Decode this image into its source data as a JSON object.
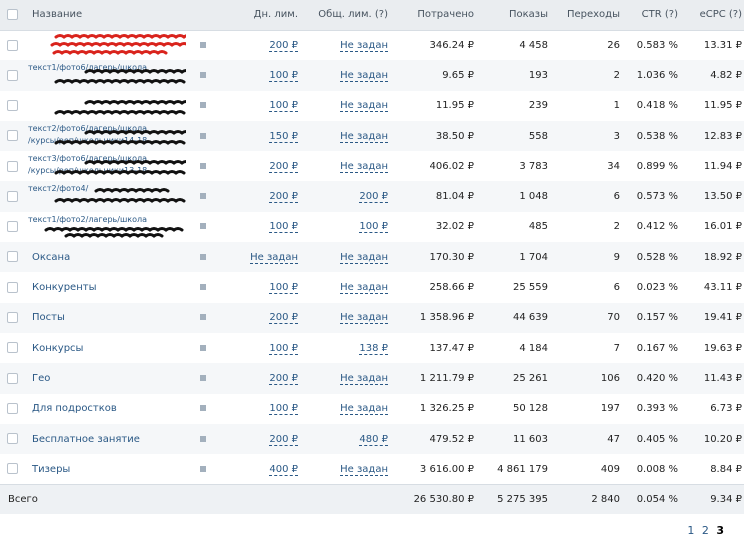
{
  "header": {
    "name": "Название",
    "daily": "Дн. лим.",
    "total_limit": "Общ. лим. (?)",
    "spent": "Потрачено",
    "impressions": "Показы",
    "clicks": "Переходы",
    "ctr": "CTR (?)",
    "ecpc": "eCPC (?)"
  },
  "rows": [
    {
      "name": "",
      "name_line2": "",
      "daily": "200 ₽",
      "total": "Не задан",
      "spent": "346.24 ₽",
      "impr": "4 458",
      "clicks": "26",
      "ctr": "0.583 %",
      "ecpc": "13.31 ₽"
    },
    {
      "name": "текст1/фото6/лагерь/школа",
      "name_line2": "",
      "daily": "100 ₽",
      "total": "Не задан",
      "spent": "9.65 ₽",
      "impr": "193",
      "clicks": "2",
      "ctr": "1.036 %",
      "ecpc": "4.82 ₽"
    },
    {
      "name": "",
      "name_line2": "",
      "daily": "100 ₽",
      "total": "Не задан",
      "spent": "11.95 ₽",
      "impr": "239",
      "clicks": "1",
      "ctr": "0.418 %",
      "ecpc": "11.95 ₽"
    },
    {
      "name": "текст2/фото6/лагерь/школа",
      "name_line2": "/курсы/реп/школьники14-18",
      "daily": "150 ₽",
      "total": "Не задан",
      "spent": "38.50 ₽",
      "impr": "558",
      "clicks": "3",
      "ctr": "0.538 %",
      "ecpc": "12.83 ₽"
    },
    {
      "name": "текст3/фото6/лагерь/школа",
      "name_line2": "/курсы/реп/школьники13-18",
      "daily": "200 ₽",
      "total": "Не задан",
      "spent": "406.02 ₽",
      "impr": "3 783",
      "clicks": "34",
      "ctr": "0.899 %",
      "ecpc": "11.94 ₽"
    },
    {
      "name": "текст2/фото4/",
      "name_line2": "",
      "daily": "200 ₽",
      "total": "200 ₽",
      "spent": "81.04 ₽",
      "impr": "1 048",
      "clicks": "6",
      "ctr": "0.573 %",
      "ecpc": "13.50 ₽"
    },
    {
      "name": "текст1/фото2/лагерь/школа",
      "name_line2": "",
      "daily": "100 ₽",
      "total": "100 ₽",
      "spent": "32.02 ₽",
      "impr": "485",
      "clicks": "2",
      "ctr": "0.412 %",
      "ecpc": "16.01 ₽"
    },
    {
      "name": "Оксана",
      "name_line2": "",
      "daily": "Не задан",
      "total": "Не задан",
      "spent": "170.30 ₽",
      "impr": "1 704",
      "clicks": "9",
      "ctr": "0.528 %",
      "ecpc": "18.92 ₽"
    },
    {
      "name": "Конкуренты",
      "name_line2": "",
      "daily": "100 ₽",
      "total": "Не задан",
      "spent": "258.66 ₽",
      "impr": "25 559",
      "clicks": "6",
      "ctr": "0.023 %",
      "ecpc": "43.11 ₽"
    },
    {
      "name": "Посты",
      "name_line2": "",
      "daily": "200 ₽",
      "total": "Не задан",
      "spent": "1 358.96 ₽",
      "impr": "44 639",
      "clicks": "70",
      "ctr": "0.157 %",
      "ecpc": "19.41 ₽"
    },
    {
      "name": "Конкурсы",
      "name_line2": "",
      "daily": "100 ₽",
      "total": "138 ₽",
      "spent": "137.47 ₽",
      "impr": "4 184",
      "clicks": "7",
      "ctr": "0.167 %",
      "ecpc": "19.63 ₽"
    },
    {
      "name": "Гео",
      "name_line2": "",
      "daily": "200 ₽",
      "total": "Не задан",
      "spent": "1 211.79 ₽",
      "impr": "25 261",
      "clicks": "106",
      "ctr": "0.420 %",
      "ecpc": "11.43 ₽"
    },
    {
      "name": "Для подростков",
      "name_line2": "",
      "daily": "100 ₽",
      "total": "Не задан",
      "spent": "1 326.25 ₽",
      "impr": "50 128",
      "clicks": "197",
      "ctr": "0.393 %",
      "ecpc": "6.73 ₽"
    },
    {
      "name": "Бесплатное занятие",
      "name_line2": "",
      "daily": "200 ₽",
      "total": "480 ₽",
      "spent": "479.52 ₽",
      "impr": "11 603",
      "clicks": "47",
      "ctr": "0.405 %",
      "ecpc": "10.20 ₽"
    },
    {
      "name": "Тизеры",
      "name_line2": "",
      "daily": "400 ₽",
      "total": "Не задан",
      "spent": "3 616.00 ₽",
      "impr": "4 861 179",
      "clicks": "409",
      "ctr": "0.008 %",
      "ecpc": "8.84 ₽"
    }
  ],
  "total": {
    "label": "Всего",
    "spent": "26 530.80 ₽",
    "impr": "5 275 395",
    "clicks": "2 840",
    "ctr": "0.054 %",
    "ecpc": "9.34 ₽"
  },
  "pagination": {
    "p1": "1",
    "p2": "2",
    "p3": "3"
  },
  "redacted_rows": [
    0,
    1,
    2,
    3,
    4,
    5,
    6
  ],
  "colors": {
    "link": "#2a5885",
    "header_bg": "#eaedf0",
    "stripe": "#f5f7f9",
    "scribble_red": "#d9231c",
    "scribble_black": "#111111"
  }
}
